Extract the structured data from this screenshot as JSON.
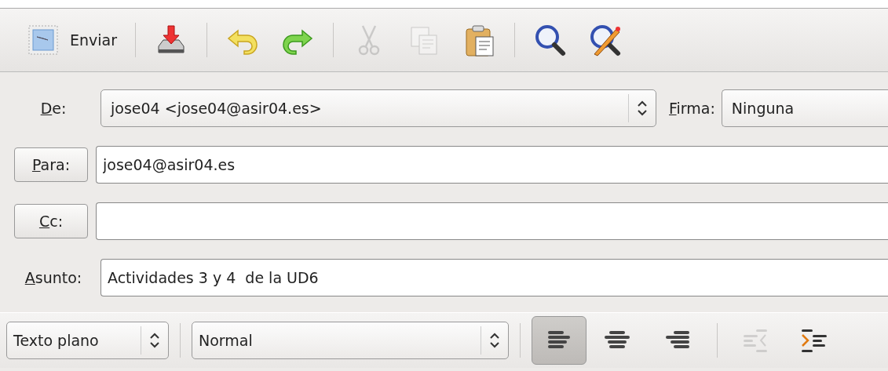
{
  "toolbar": [
    {
      "kind": "send",
      "label": "Enviar",
      "disabled": false
    },
    {
      "kind": "separator"
    },
    {
      "kind": "save",
      "disabled": false
    },
    {
      "kind": "separator"
    },
    {
      "kind": "undo",
      "disabled": false
    },
    {
      "kind": "redo",
      "disabled": false
    },
    {
      "kind": "separator"
    },
    {
      "kind": "cut",
      "disabled": true
    },
    {
      "kind": "copy",
      "disabled": true
    },
    {
      "kind": "paste",
      "disabled": false
    },
    {
      "kind": "separator"
    },
    {
      "kind": "find",
      "disabled": false
    },
    {
      "kind": "replace",
      "disabled": false
    }
  ],
  "header": {
    "from": {
      "label": {
        "key": "D",
        "rest": "e:"
      },
      "value": "jose04 <jose04@asir04.es>"
    },
    "signature": {
      "label": {
        "key": "F",
        "rest": "irma:"
      },
      "value": "Ninguna"
    },
    "to": {
      "label": {
        "key": "P",
        "rest": "ara:"
      },
      "value": "jose04@asir04.es"
    },
    "cc": {
      "label": {
        "key": "C",
        "rest": "c:"
      }
    },
    "subject": {
      "label": {
        "key": "A",
        "rest": "sunto:"
      },
      "value": "Actividades 3 y 4  de la UD6"
    }
  },
  "format_bar": [
    {
      "kind": "format-combo",
      "value": "Texto plano"
    },
    {
      "kind": "separator"
    },
    {
      "kind": "style-combo",
      "value": "Normal"
    },
    {
      "kind": "separator"
    },
    {
      "kind": "align-left",
      "selected": true,
      "disabled": false
    },
    {
      "kind": "align-center",
      "selected": false,
      "disabled": false
    },
    {
      "kind": "align-right",
      "selected": false,
      "disabled": false
    },
    {
      "kind": "separator"
    },
    {
      "kind": "outdent",
      "selected": false,
      "disabled": true
    },
    {
      "kind": "indent",
      "selected": false,
      "disabled": false
    }
  ]
}
